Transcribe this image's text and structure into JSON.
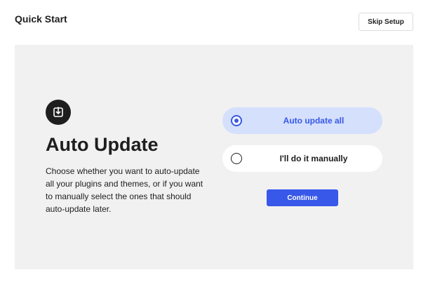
{
  "header": {
    "title": "Quick Start",
    "skip_label": "Skip Setup"
  },
  "step": {
    "icon": "download-icon",
    "heading": "Auto Update",
    "description": "Choose whether you want to auto-update all your plugins and themes, or if you want to manually select the ones that should auto-update later."
  },
  "options": [
    {
      "label": "Auto update all",
      "selected": true
    },
    {
      "label": "I'll do it manually",
      "selected": false
    }
  ],
  "continue_label": "Continue",
  "colors": {
    "accent": "#3858e9",
    "selected_bg": "#d4e0fc",
    "panel_bg": "#f1f1f1",
    "text": "#1e1e1e"
  }
}
